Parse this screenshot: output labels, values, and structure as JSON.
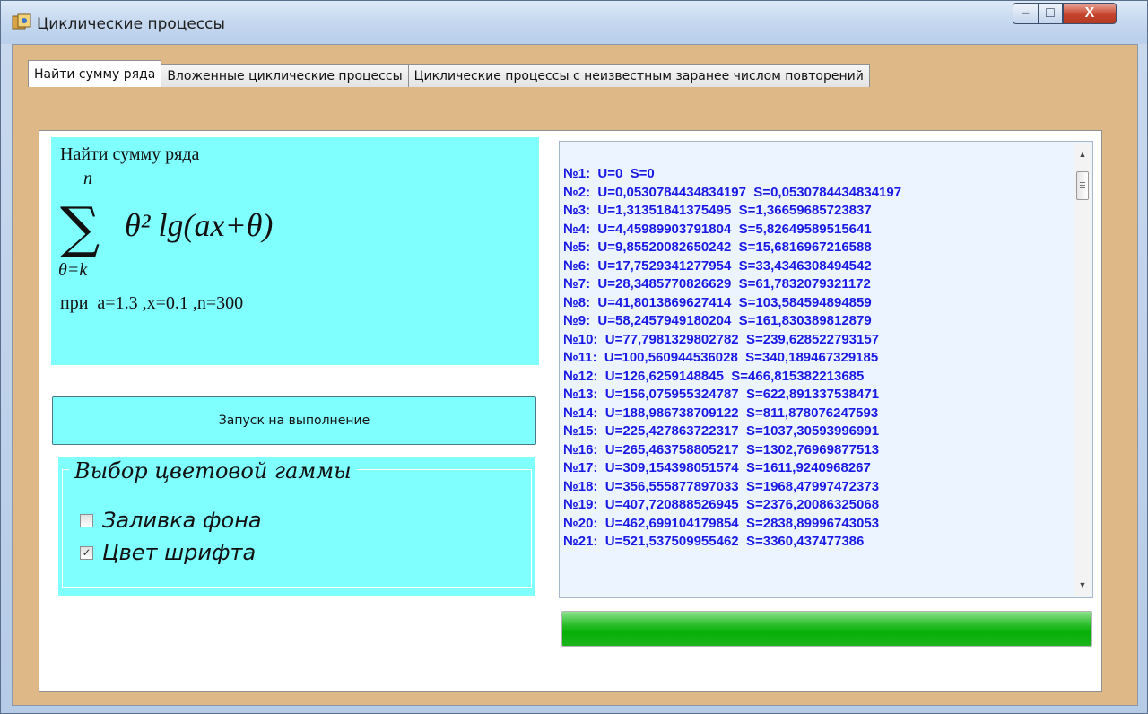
{
  "window": {
    "title": "Циклические процессы",
    "minimize_glyph": "–",
    "maximize_glyph": "□",
    "close_glyph": "X"
  },
  "tabs": [
    {
      "label": "Найти сумму ряда",
      "active": true
    },
    {
      "label": "Вложенные циклические процессы",
      "active": false
    },
    {
      "label": "Циклические процессы с неизвестным заранее числом повторений",
      "active": false
    }
  ],
  "formula": {
    "title": "Найти сумму ряда",
    "upper_limit": "n",
    "lower_limit": "θ=k",
    "expression": "θ² lg(ax+θ)",
    "params": "при  a=1.3 ,x=0.1 ,n=300"
  },
  "run_button": {
    "label": "Запуск на выполнение"
  },
  "color_group": {
    "legend": "Выбор цветовой гаммы",
    "options": [
      {
        "label": "Заливка фона",
        "checked": false
      },
      {
        "label": "Цвет шрифта",
        "checked": true
      }
    ]
  },
  "results": [
    "№1:  U=0  S=0",
    "№2:  U=0,0530784434834197  S=0,0530784434834197",
    "№3:  U=1,31351841375495  S=1,36659685723837",
    "№4:  U=4,45989903791804  S=5,82649589515641",
    "№5:  U=9,85520082650242  S=15,6816967216588",
    "№6:  U=17,7529341277954  S=33,4346308494542",
    "№7:  U=28,3485770826629  S=61,7832079321172",
    "№8:  U=41,8013869627414  S=103,584594894859",
    "№9:  U=58,2457949180204  S=161,830389812879",
    "№10:  U=77,7981329802782  S=239,628522793157",
    "№11:  U=100,560944536028  S=340,189467329185",
    "№12:  U=126,6259148845  S=466,815382213685",
    "№13:  U=156,075955324787  S=622,891337538471",
    "№14:  U=188,986738709122  S=811,878076247593",
    "№15:  U=225,427863722317  S=1037,30593996991",
    "№16:  U=265,463758805217  S=1302,76969877513",
    "№17:  U=309,154398051574  S=1611,9240968267",
    "№18:  U=356,555877897033  S=1968,47997472373",
    "№19:  U=407,720888526945  S=2376,20086325068",
    "№20:  U=462,699104179854  S=2838,89996743053",
    "№21:  U=521,537509955462  S=3360,437477386"
  ],
  "progress": {
    "value": 1.0
  },
  "colors": {
    "form_background": "#deb887",
    "panel_cyan": "#80ffff",
    "list_text": "#1a1ae6",
    "progress_green": "#06b006"
  },
  "icons": {
    "app": "app-icon",
    "minimize": "minimize-icon",
    "maximize": "maximize-icon",
    "close": "close-icon",
    "scroll_up": "scroll-up-arrow-icon",
    "scroll_down": "scroll-down-arrow-icon",
    "checkmark": "checkmark-icon"
  }
}
